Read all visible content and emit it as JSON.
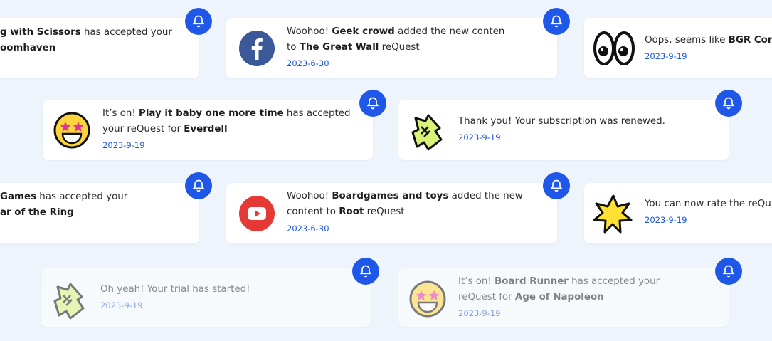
{
  "notifications": [
    {
      "id": "n1",
      "pre": "",
      "b1": "g with Scissors",
      "mid": " has accepted your",
      "line2_pre": "",
      "b2": "oomhaven",
      "line2_post": "",
      "date": ""
    },
    {
      "id": "n2",
      "pre": "Woohoo! ",
      "b1": "Geek crowd",
      "mid": " added the new conten",
      "line2_pre": " to ",
      "b2": "The Great Wall",
      "line2_post": " reQuest",
      "date": "2023-6-30",
      "icon": "facebook-icon"
    },
    {
      "id": "n3",
      "pre": "Oops, seems like ",
      "b1": "BGR Con",
      "mid": "",
      "date": "2023-9-19",
      "icon": "eyes-icon"
    },
    {
      "id": "n4",
      "pre": "It’s on! ",
      "b1": "Play it baby one more time",
      "mid": " has accepted",
      "line2_pre": "your reQuest for ",
      "b2": "Everdell",
      "line2_post": "",
      "date": "2023-9-19",
      "icon": "star-struck-emoji-icon"
    },
    {
      "id": "n5",
      "pre": "Thank you! Your subscription was renewed.",
      "date": "2023-9-19",
      "icon": "puzzle-logo-icon"
    },
    {
      "id": "n6",
      "pre": "",
      "b1": "Games",
      "mid": " has accepted your",
      "line2_pre": "",
      "b2": "ar of the Ring",
      "line2_post": "",
      "date": ""
    },
    {
      "id": "n7",
      "pre": "Woohoo! ",
      "b1": "Boardgames and toys",
      "mid": " added the new",
      "line2_pre": "content to ",
      "b2": "Root",
      "line2_post": " reQuest",
      "date": "2023-6-30",
      "icon": "youtube-icon"
    },
    {
      "id": "n8",
      "pre": "You can now rate the reQu",
      "date": "2023-9-19",
      "icon": "star-burst-icon"
    },
    {
      "id": "n9",
      "pre": "Oh yeah! Your trial has started!",
      "date": "2023-9-19",
      "icon": "puzzle-logo-icon"
    },
    {
      "id": "n10",
      "pre": "It’s on! ",
      "b1": "Board Runner",
      "mid": " has accepted your",
      "line2_pre": "reQuest for ",
      "b2": "Age of Napoleon",
      "line2_post": "",
      "date": "2023-9-19",
      "icon": "star-struck-emoji-icon"
    }
  ],
  "colors": {
    "accent": "#1f57e8",
    "date": "#1d56d9",
    "background": "#eef4fb",
    "facebook": "#3b5998",
    "youtube": "#e53935"
  }
}
